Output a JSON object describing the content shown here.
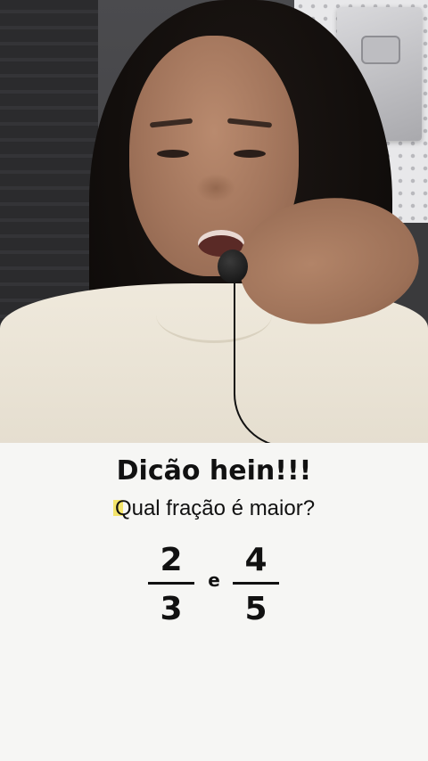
{
  "header": {
    "title": "Dicão hein!!!",
    "question": "Qual fração é maior?"
  },
  "fractions": {
    "first": {
      "numerator": "2",
      "denominator": "3"
    },
    "conjunction": "e",
    "second": {
      "numerator": "4",
      "denominator": "5"
    }
  },
  "colors": {
    "panel_background": "#f6f6f4",
    "text": "#111111",
    "highlight": "#f3e46b"
  },
  "icons": {
    "text_cursor": "text-highlight-mark"
  }
}
